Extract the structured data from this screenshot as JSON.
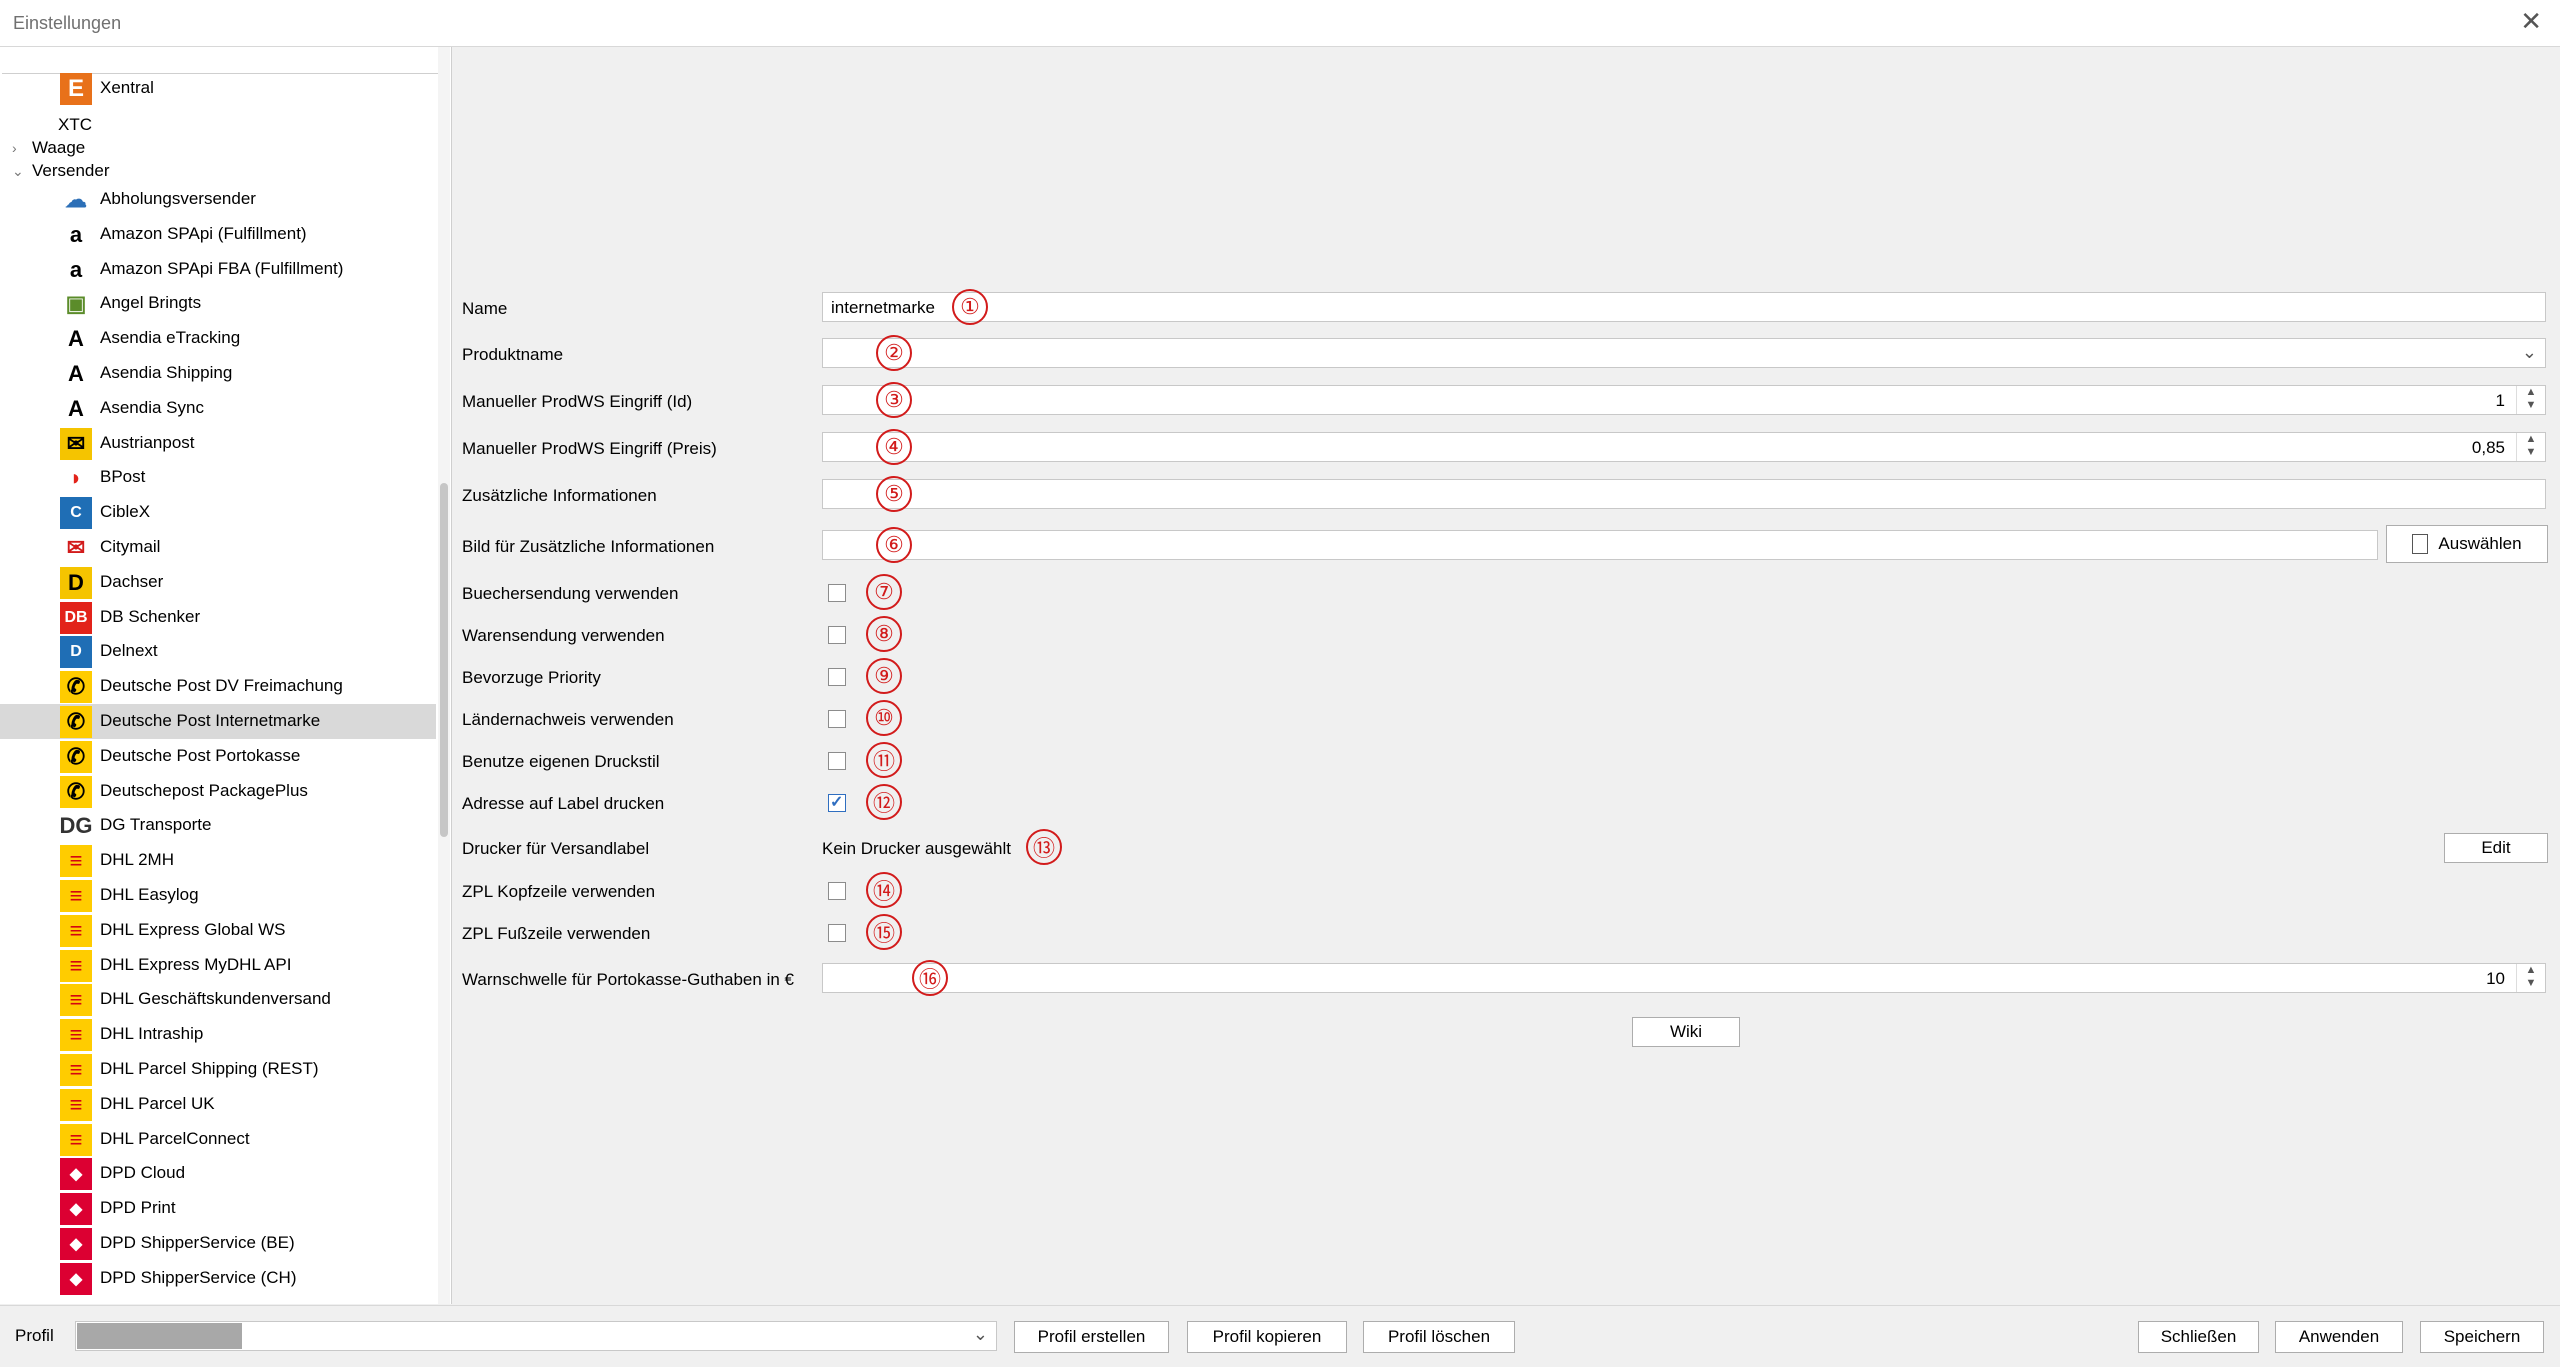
{
  "window": {
    "title": "Einstellungen",
    "close": "✕"
  },
  "tree": {
    "xentral": "Xentral",
    "xtc": "XTC",
    "waage": "Waage",
    "versender": "Versender",
    "items": [
      {
        "label": "Abholungsversender",
        "icon": "cloud-icon",
        "color": "#2c6fb7",
        "glyph": "☁"
      },
      {
        "label": "Amazon SPApi (Fulfillment)",
        "icon": "amazon-icon",
        "color": "#000000",
        "glyph": "a"
      },
      {
        "label": "Amazon SPApi FBA (Fulfillment)",
        "icon": "amazon-icon",
        "color": "#000000",
        "glyph": "a"
      },
      {
        "label": "Angel Bringts",
        "icon": "angel-icon",
        "color": "#5b8c2a",
        "glyph": "▣"
      },
      {
        "label": "Asendia eTracking",
        "icon": "asendia-icon",
        "color": "#000000",
        "glyph": "A"
      },
      {
        "label": "Asendia Shipping",
        "icon": "asendia-icon",
        "color": "#000000",
        "glyph": "A"
      },
      {
        "label": "Asendia Sync",
        "icon": "asendia-icon",
        "color": "#000000",
        "glyph": "A"
      },
      {
        "label": "Austrianpost",
        "icon": "austrianpost-icon",
        "color": "#f5c400",
        "glyph": "✉"
      },
      {
        "label": "BPost",
        "icon": "bpost-icon",
        "color": "#e2231a",
        "glyph": "◗"
      },
      {
        "label": "CibleX",
        "icon": "ciblex-icon",
        "color": "#1f6eb5",
        "glyph": "C"
      },
      {
        "label": "Citymail",
        "icon": "citymail-icon",
        "color": "#d21b1b",
        "glyph": "✉"
      },
      {
        "label": "Dachser",
        "icon": "dachser-icon",
        "color": "#f5c400",
        "glyph": "D"
      },
      {
        "label": "DB Schenker",
        "icon": "dbschenker-icon",
        "color": "#e2231a",
        "glyph": "DB"
      },
      {
        "label": "Delnext",
        "icon": "delnext-icon",
        "color": "#1f6eb5",
        "glyph": "D"
      },
      {
        "label": "Deutsche Post DV Freimachung",
        "icon": "deutschepost-icon",
        "color": "#ffcc00",
        "glyph": "✆"
      },
      {
        "label": "Deutsche Post Internetmarke",
        "icon": "deutschepost-icon",
        "color": "#ffcc00",
        "glyph": "✆"
      },
      {
        "label": "Deutsche Post Portokasse",
        "icon": "deutschepost-icon",
        "color": "#ffcc00",
        "glyph": "✆"
      },
      {
        "label": "Deutschepost PackagePlus",
        "icon": "deutschepost-icon",
        "color": "#ffcc00",
        "glyph": "✆"
      },
      {
        "label": "DG Transporte",
        "icon": "dg-icon",
        "color": "#333333",
        "glyph": "DG"
      },
      {
        "label": "DHL 2MH",
        "icon": "dhl-icon",
        "color": "#ffcc00",
        "glyph": "≡"
      },
      {
        "label": "DHL Easylog",
        "icon": "dhl-icon",
        "color": "#ffcc00",
        "glyph": "≡"
      },
      {
        "label": "DHL Express Global WS",
        "icon": "dhl-icon",
        "color": "#ffcc00",
        "glyph": "≡"
      },
      {
        "label": "DHL Express MyDHL API",
        "icon": "dhl-icon",
        "color": "#ffcc00",
        "glyph": "≡"
      },
      {
        "label": "DHL Geschäftskundenversand",
        "icon": "dhl-icon",
        "color": "#ffcc00",
        "glyph": "≡"
      },
      {
        "label": "DHL Intraship",
        "icon": "dhl-icon",
        "color": "#ffcc00",
        "glyph": "≡"
      },
      {
        "label": "DHL Parcel Shipping (REST)",
        "icon": "dhl-icon",
        "color": "#ffcc00",
        "glyph": "≡"
      },
      {
        "label": "DHL Parcel UK",
        "icon": "dhl-icon",
        "color": "#ffcc00",
        "glyph": "≡"
      },
      {
        "label": "DHL ParcelConnect",
        "icon": "dhl-icon",
        "color": "#ffcc00",
        "glyph": "≡"
      },
      {
        "label": "DPD Cloud",
        "icon": "dpd-icon",
        "color": "#dc0032",
        "glyph": "◆"
      },
      {
        "label": "DPD Print",
        "icon": "dpd-icon",
        "color": "#dc0032",
        "glyph": "◆"
      },
      {
        "label": "DPD ShipperService (BE)",
        "icon": "dpd-icon",
        "color": "#dc0032",
        "glyph": "◆"
      },
      {
        "label": "DPD ShipperService (CH)",
        "icon": "dpd-icon",
        "color": "#dc0032",
        "glyph": "◆"
      }
    ],
    "selected_index": 15
  },
  "form": {
    "name_label": "Name",
    "name_value": "internetmarke",
    "produktname_label": "Produktname",
    "prodws_id_label": "Manueller ProdWS Eingriff (Id)",
    "prodws_id_value": "1",
    "prodws_preis_label": "Manueller ProdWS Eingriff (Preis)",
    "prodws_preis_value": "0,85",
    "zusatz_label": "Zusätzliche Informationen",
    "bild_label": "Bild für Zusätzliche Informationen",
    "auswaehlen": "Auswählen",
    "buecher_label": "Buechersendung verwenden",
    "waren_label": "Warensendung verwenden",
    "priority_label": "Bevorzuge Priority",
    "laender_label": "Ländernachweis verwenden",
    "druckstil_label": "Benutze eigenen Druckstil",
    "adresse_label": "Adresse auf Label drucken",
    "drucker_label": "Drucker für Versandlabel",
    "drucker_value": "Kein Drucker ausgewählt",
    "edit": "Edit",
    "zpl_kopf_label": "ZPL Kopfzeile verwenden",
    "zpl_fuss_label": "ZPL Fußzeile verwenden",
    "warn_label": "Warnschwelle für Portokasse-Guthaben in €",
    "warn_value": "10",
    "wiki": "Wiki",
    "checkboxes": {
      "buecher": false,
      "waren": false,
      "priority": false,
      "laender": false,
      "druckstil": false,
      "adresse": true,
      "zpl_kopf": false,
      "zpl_fuss": false
    }
  },
  "annotations": [
    "①",
    "②",
    "③",
    "④",
    "⑤",
    "⑥",
    "⑦",
    "⑧",
    "⑨",
    "⑩",
    "⑪",
    "⑫",
    "⑬",
    "⑭",
    "⑮",
    "⑯"
  ],
  "footer": {
    "profil_label": "Profil",
    "profil_erstellen": "Profil erstellen",
    "profil_kopieren": "Profil kopieren",
    "profil_loeschen": "Profil löschen",
    "schliessen": "Schließen",
    "anwenden": "Anwenden",
    "speichern": "Speichern"
  },
  "colors": {
    "annotation": "#d21b1b",
    "checkbox_checked": "#2f6ec0",
    "selection": "#d9d9d9"
  }
}
